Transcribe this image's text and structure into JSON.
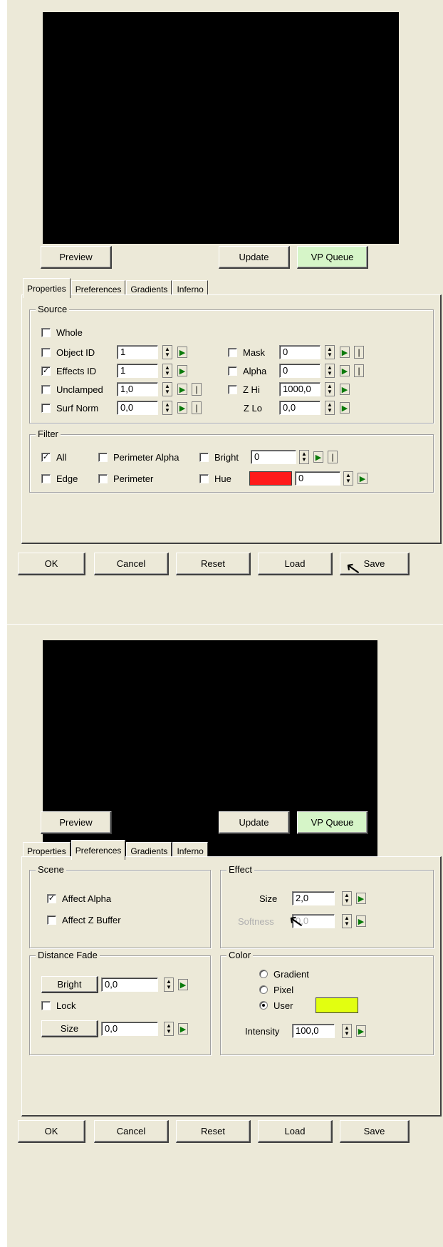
{
  "colors": {
    "panel_bg": "#ece9d8",
    "preview_bg": "#000000",
    "vp_queue_bg": "#d6f5c8",
    "hue_swatch": "#ff1a1a",
    "user_color_swatch": "#e2ff10"
  },
  "icons": {
    "spinner": "up-down-arrows",
    "play": "play-icon",
    "lock": "lock-icon",
    "cursor": "mouse-cursor"
  },
  "top": {
    "preview_button": "Preview",
    "update_button": "Update",
    "vp_queue_button": "VP Queue",
    "tabs": [
      "Properties",
      "Preferences",
      "Gradients",
      "Inferno"
    ],
    "active_tab": "Properties",
    "source": {
      "title": "Source",
      "whole": {
        "label": "Whole",
        "checked": false
      },
      "object_id": {
        "label": "Object ID",
        "value": "1",
        "checked": false
      },
      "effects_id": {
        "label": "Effects ID",
        "value": "1",
        "checked": true
      },
      "unclamped": {
        "label": "Unclamped",
        "value": "1,0",
        "checked": false
      },
      "surf_norm": {
        "label": "Surf Norm",
        "value": "0,0",
        "checked": false
      },
      "mask": {
        "label": "Mask",
        "value": "0",
        "checked": false
      },
      "alpha": {
        "label": "Alpha",
        "value": "0",
        "checked": false
      },
      "z_hi": {
        "label": "Z Hi",
        "value": "1000,0",
        "checked": false
      },
      "z_lo": {
        "label": "Z Lo",
        "value": "0,0"
      }
    },
    "filter": {
      "title": "Filter",
      "all": {
        "label": "All",
        "checked": true
      },
      "edge": {
        "label": "Edge",
        "checked": false
      },
      "perimeter_alpha": {
        "label": "Perimeter Alpha",
        "checked": false
      },
      "perimeter": {
        "label": "Perimeter",
        "checked": false
      },
      "bright": {
        "label": "Bright",
        "value": "0",
        "checked": false
      },
      "hue": {
        "label": "Hue",
        "value": "0",
        "checked": false
      }
    },
    "footer": {
      "ok": "OK",
      "cancel": "Cancel",
      "reset": "Reset",
      "load": "Load",
      "save": "Save"
    }
  },
  "bottom": {
    "preview_button": "Preview",
    "update_button": "Update",
    "vp_queue_button": "VP Queue",
    "tabs": [
      "Properties",
      "Preferences",
      "Gradients",
      "Inferno"
    ],
    "active_tab": "Preferences",
    "scene": {
      "title": "Scene",
      "affect_alpha": {
        "label": "Affect Alpha",
        "checked": true
      },
      "affect_z_buffer": {
        "label": "Affect Z Buffer",
        "checked": false
      }
    },
    "effect": {
      "title": "Effect",
      "size": {
        "label": "Size",
        "value": "2,0"
      },
      "softness": {
        "label": "Softness",
        "value": "0,0",
        "disabled": true
      }
    },
    "distance_fade": {
      "title": "Distance Fade",
      "bright": {
        "label": "Bright",
        "value": "0,0"
      },
      "lock": {
        "label": "Lock",
        "checked": false
      },
      "size": {
        "label": "Size",
        "value": "0,0"
      }
    },
    "color": {
      "title": "Color",
      "options": [
        "Gradient",
        "Pixel",
        "User"
      ],
      "selected": "User",
      "intensity": {
        "label": "Intensity",
        "value": "100,0"
      }
    },
    "footer": {
      "ok": "OK",
      "cancel": "Cancel",
      "reset": "Reset",
      "load": "Load",
      "save": "Save"
    }
  }
}
